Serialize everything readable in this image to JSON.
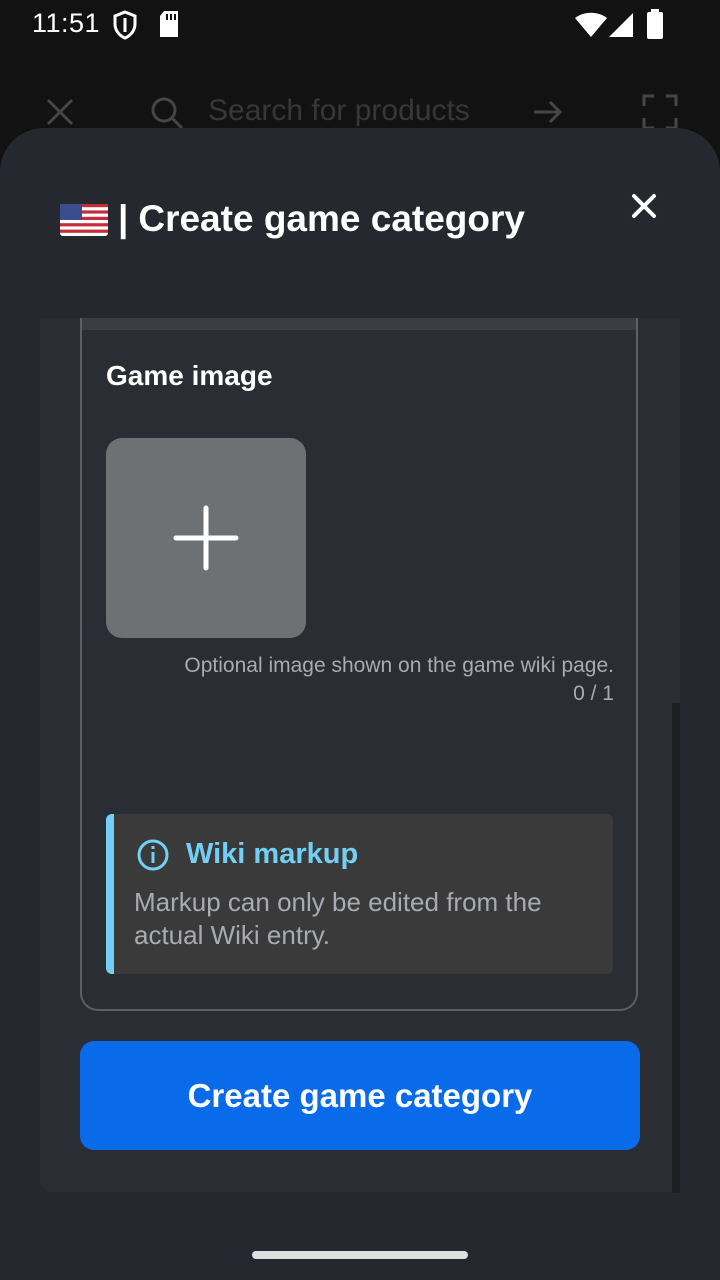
{
  "status_bar": {
    "time": "11:51",
    "icons": [
      "shield-icon",
      "sd-card-icon",
      "wifi-icon",
      "signal-icon",
      "battery-icon"
    ]
  },
  "background_app": {
    "search_placeholder": "Search for products",
    "icons": [
      "close-icon",
      "search-icon",
      "arrow-right-icon",
      "scan-icon"
    ]
  },
  "sheet": {
    "separator": "|",
    "title": "Create game category",
    "flag_icon": "us-flag-icon",
    "close_icon": "close-icon"
  },
  "game_image": {
    "section_title": "Game image",
    "add_icon": "plus-icon",
    "helper_text": "Optional image shown on the game wiki page.",
    "counter": "0 / 1"
  },
  "notice": {
    "icon": "info-icon",
    "title": "Wiki markup",
    "body": "Markup can only be edited from the actual Wiki entry.",
    "accent_color": "#73d0f4"
  },
  "actions": {
    "submit_label": "Create game category",
    "submit_color": "#0a6bea"
  }
}
